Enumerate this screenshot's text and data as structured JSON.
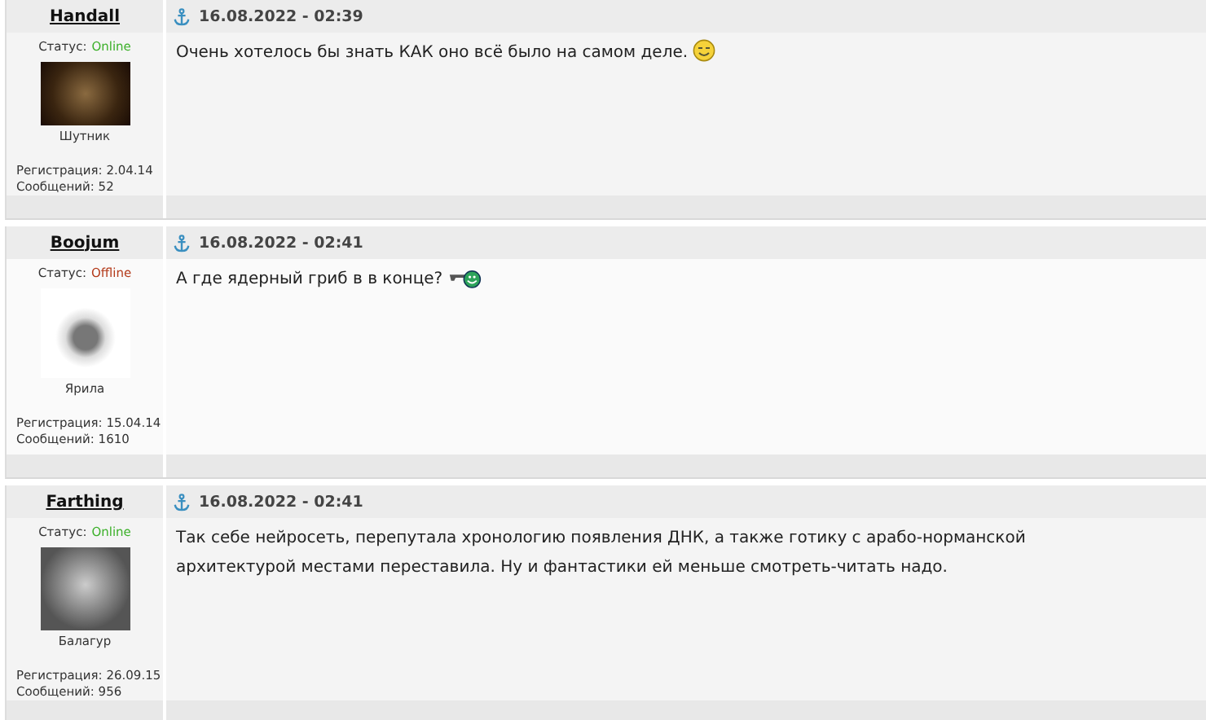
{
  "posts": [
    {
      "author": "Handall",
      "date": "16.08.2022 - 02:39",
      "status_label": "Статус:",
      "status": "Online",
      "online": true,
      "rank": "Шутник",
      "reg_label": "Регистрация:",
      "reg": "2.04.14",
      "msg_label": "Сообщений:",
      "msgs": "52",
      "text": "Очень хотелось бы знать КАК оно всё было на самом деле.",
      "emoji": {
        "kind": "smile"
      }
    },
    {
      "author": "Boojum",
      "date": "16.08.2022 - 02:41",
      "status_label": "Статус:",
      "status": "Offline",
      "online": false,
      "rank": "Ярила",
      "reg_label": "Регистрация:",
      "reg": "15.04.14",
      "msg_label": "Сообщений:",
      "msgs": "1610",
      "text": "А где ядерный гриб в в конце?",
      "emoji": {
        "kind": "gun"
      }
    },
    {
      "author": "Farthing",
      "date": "16.08.2022 - 02:41",
      "status_label": "Статус:",
      "status": "Online",
      "online": true,
      "rank": "Балагур",
      "reg_label": "Регистрация:",
      "reg": "26.09.15",
      "msg_label": "Сообщений:",
      "msgs": "956",
      "text": "Так себе нейросеть, перепутала хронологию появления ДНК, а также готику с арабо-норманской архитектурой местами переставила. Ну и фантастики ей меньше смотреть-читать надо."
    }
  ]
}
